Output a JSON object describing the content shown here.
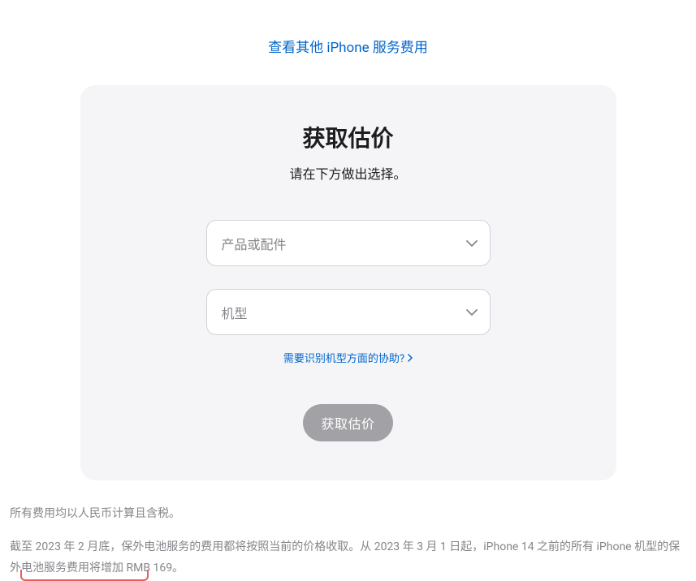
{
  "top_link": "查看其他 iPhone 服务费用",
  "card": {
    "title": "获取估价",
    "subtitle": "请在下方做出选择。",
    "select1_placeholder": "产品或配件",
    "select2_placeholder": "机型",
    "help_link": "需要识别机型方面的协助?",
    "button": "获取估价"
  },
  "footer": {
    "line1": "所有费用均以人民币计算且含税。",
    "line2_part1": "截至 2023 年 2 月底，保外电池服务的费用都将按照当前的价格收取。从 2023 年 3 月 1 日起，iPhone 14 之前的所有 iPhone 机型的保外电池服务",
    "line2_part2": "费用将增加 RMB 169。"
  }
}
